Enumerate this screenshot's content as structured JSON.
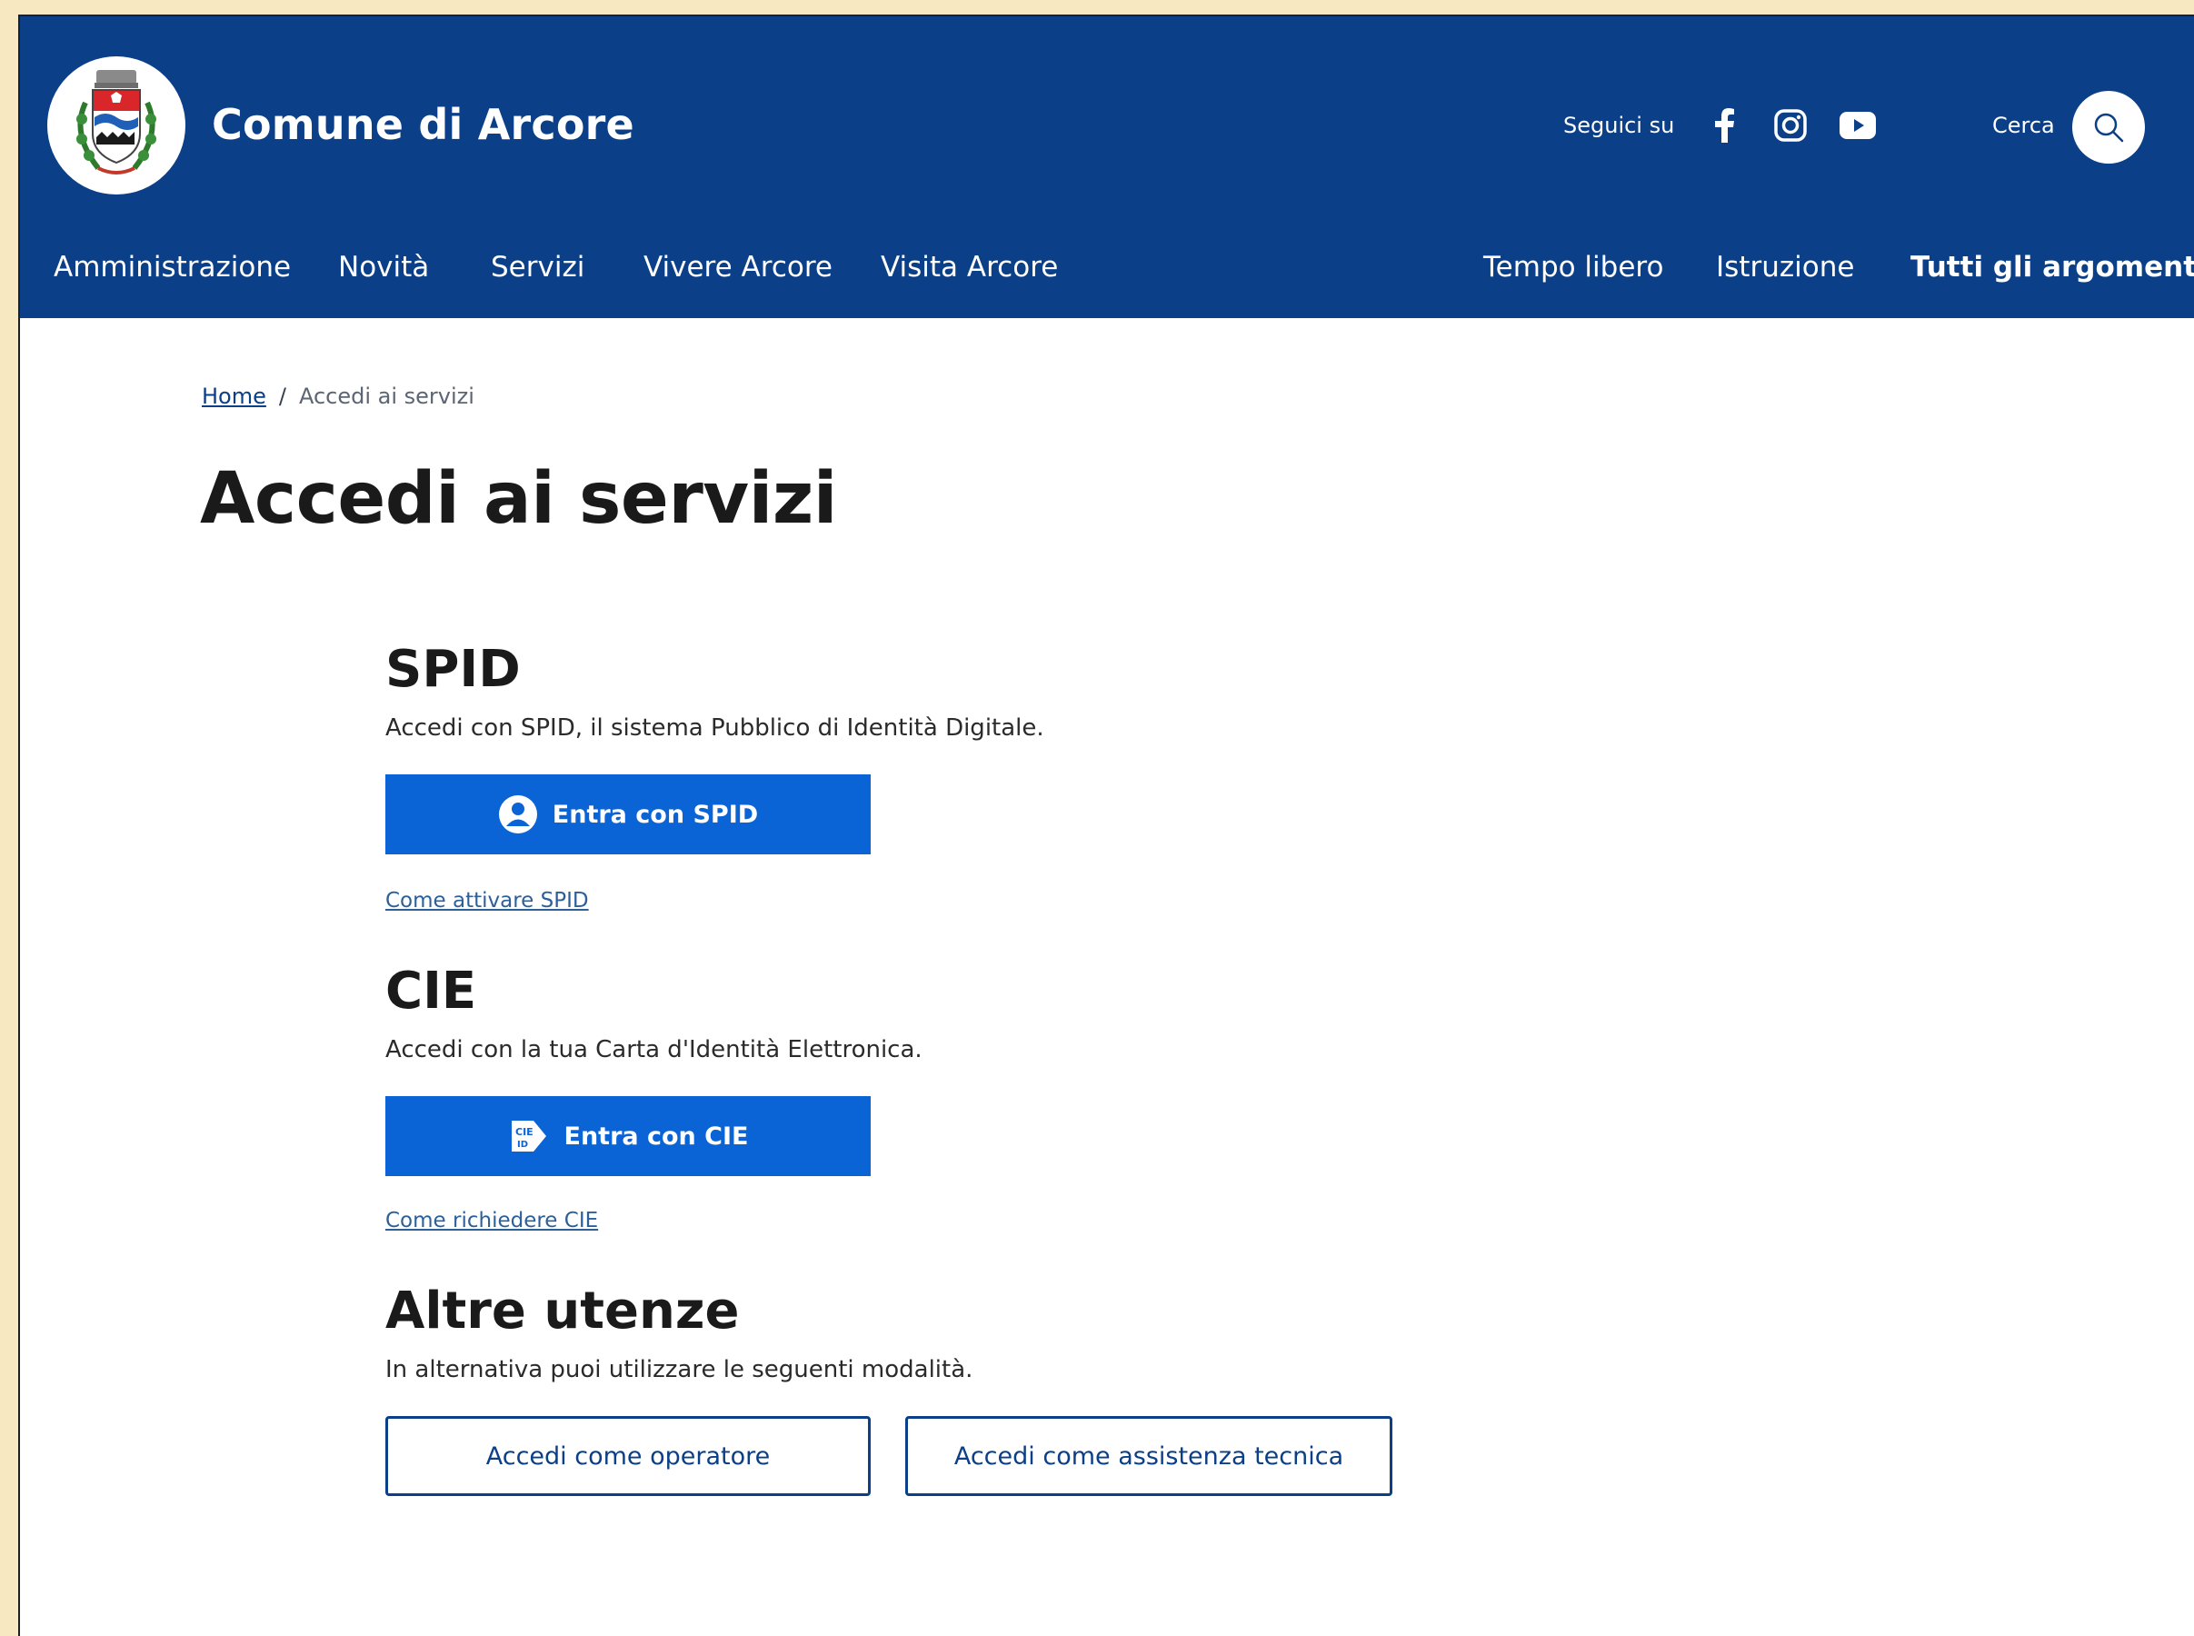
{
  "colors": {
    "header_bg": "#0b3f87",
    "primary_button": "#0b64d6",
    "outline_button_border": "#0b3f87",
    "page_bg": "#f7e8c2"
  },
  "header": {
    "site_title": "Comune di Arcore",
    "logo_icon": "municipal-coat-of-arms",
    "social_label": "Seguici su",
    "social_icons": [
      "facebook-icon",
      "instagram-icon",
      "youtube-icon"
    ],
    "search_label": "Cerca",
    "search_icon": "search-icon"
  },
  "nav": {
    "items": [
      "Amministrazione",
      "Novità",
      "Servizi",
      "Vivere Arcore",
      "Visita Arcore"
    ],
    "secondary": [
      "Tempo libero",
      "Istruzione",
      "Tutti gli argomenti..."
    ]
  },
  "breadcrumb": {
    "home": "Home",
    "separator": "/",
    "current": "Accedi ai servizi"
  },
  "main": {
    "title": "Accedi ai servizi",
    "spid": {
      "title": "SPID",
      "description": "Accedi con SPID, il sistema Pubblico di Identità Digitale.",
      "button_label": "Entra con SPID",
      "button_icon": "user-icon",
      "help_link": "Come attivare SPID"
    },
    "cie": {
      "title": "CIE",
      "description": "Accedi con la tua Carta d'Identità Elettronica.",
      "button_label": "Entra con CIE",
      "button_icon": "cie-id-icon",
      "help_link": "Come richiedere CIE"
    },
    "altre": {
      "title": "Altre utenze",
      "description": "In alternativa puoi utilizzare le seguenti modalità.",
      "operator_button": "Accedi come operatore",
      "support_button": "Accedi come assistenza tecnica"
    }
  }
}
